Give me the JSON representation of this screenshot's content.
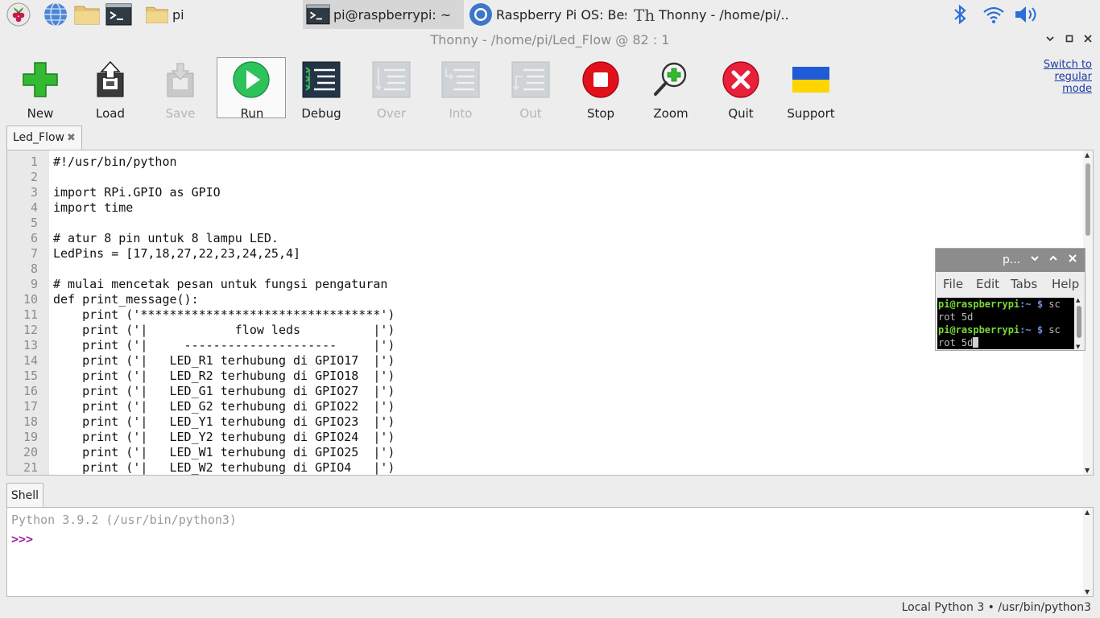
{
  "taskbar": {
    "folder_label": "pi",
    "tasks": [
      {
        "label": "pi@raspberrypi: ~",
        "active": true
      },
      {
        "label": "Raspberry Pi OS: Bes..."
      },
      {
        "label": "Thonny  -  /home/pi/..."
      }
    ]
  },
  "window": {
    "title": "Thonny  -  /home/pi/Led_Flow  @  82 : 1"
  },
  "toolbar": {
    "buttons": [
      {
        "label": "New",
        "icon": "new-file-icon",
        "enabled": true
      },
      {
        "label": "Load",
        "icon": "load-icon",
        "enabled": true
      },
      {
        "label": "Save",
        "icon": "save-icon",
        "enabled": false
      },
      {
        "label": "Run",
        "icon": "run-icon",
        "enabled": true,
        "pressed": true
      },
      {
        "label": "Debug",
        "icon": "debug-icon",
        "enabled": true
      },
      {
        "label": "Over",
        "icon": "step-over-icon",
        "enabled": false
      },
      {
        "label": "Into",
        "icon": "step-into-icon",
        "enabled": false
      },
      {
        "label": "Out",
        "icon": "step-out-icon",
        "enabled": false
      },
      {
        "label": "Stop",
        "icon": "stop-icon",
        "enabled": true
      },
      {
        "label": "Zoom",
        "icon": "zoom-icon",
        "enabled": true
      },
      {
        "label": "Quit",
        "icon": "quit-icon",
        "enabled": true
      },
      {
        "label": "Support",
        "icon": "ukraine-flag-icon",
        "enabled": true
      }
    ],
    "switch_mode_line1": "Switch to",
    "switch_mode_line2": "regular",
    "switch_mode_line3": "mode"
  },
  "editor": {
    "tab_label": "Led_Flow",
    "lines": [
      {
        "n": "1",
        "code": "#!/usr/bin/python"
      },
      {
        "n": "2",
        "code": ""
      },
      {
        "n": "3",
        "code": "import RPi.GPIO as GPIO"
      },
      {
        "n": "4",
        "code": "import time"
      },
      {
        "n": "5",
        "code": ""
      },
      {
        "n": "6",
        "code": "# atur 8 pin untuk 8 lampu LED."
      },
      {
        "n": "7",
        "code": "LedPins = [17,18,27,22,23,24,25,4]"
      },
      {
        "n": "8",
        "code": ""
      },
      {
        "n": "9",
        "code": "# mulai mencetak pesan untuk fungsi pengaturan"
      },
      {
        "n": "10",
        "code": "def print_message():"
      },
      {
        "n": "11",
        "code": "    print ('*********************************')"
      },
      {
        "n": "12",
        "code": "    print ('|            flow leds          |')"
      },
      {
        "n": "13",
        "code": "    print ('|     ---------------------     |')"
      },
      {
        "n": "14",
        "code": "    print ('|   LED_R1 terhubung di GPIO17  |')"
      },
      {
        "n": "15",
        "code": "    print ('|   LED_R2 terhubung di GPIO18  |')"
      },
      {
        "n": "16",
        "code": "    print ('|   LED_G1 terhubung di GPIO27  |')"
      },
      {
        "n": "17",
        "code": "    print ('|   LED_G2 terhubung di GPIO22  |')"
      },
      {
        "n": "18",
        "code": "    print ('|   LED_Y1 terhubung di GPIO23  |')"
      },
      {
        "n": "19",
        "code": "    print ('|   LED_Y2 terhubung di GPIO24  |')"
      },
      {
        "n": "20",
        "code": "    print ('|   LED_W1 terhubung di GPIO25  |')"
      },
      {
        "n": "21",
        "code": "    print ('|   LED_W2 terhubung di GPIO4   |')"
      }
    ]
  },
  "terminal": {
    "title": "p...",
    "menu": [
      "File",
      "Edit",
      "Tabs",
      "Help"
    ],
    "prompt_user": "pi@raspberrypi",
    "prompt_path": ":~ $ ",
    "cmd1": "sc",
    "out1": "rot 5d",
    "cmd2": "sc",
    "out2": "rot 5d"
  },
  "shell": {
    "tab_label": "Shell",
    "banner": "Python 3.9.2 (/usr/bin/python3)",
    "prompt": ">>>"
  },
  "status_bar": {
    "text": "Local Python 3  •  /usr/bin/python3"
  },
  "colors": {
    "run_green": "#2ec25a",
    "stop_red": "#e1111b",
    "link_blue": "#1a3aa6",
    "prompt_purple": "#9b1fa6"
  }
}
